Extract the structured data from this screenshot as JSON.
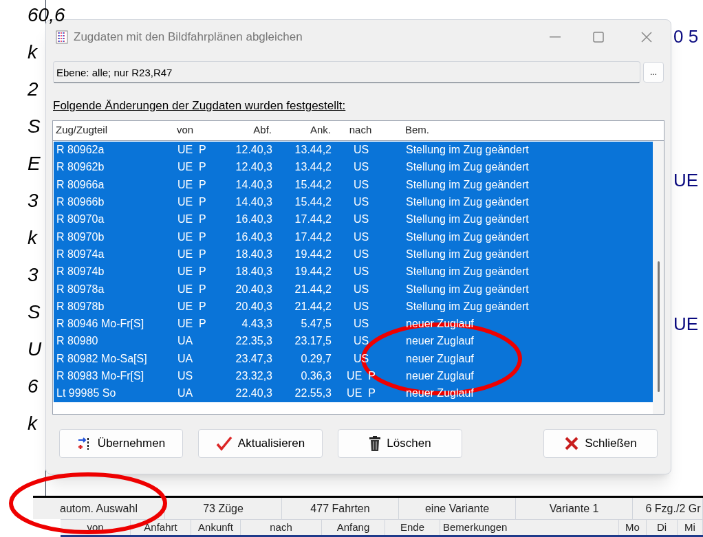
{
  "background": {
    "left_fragments": [
      "60,6",
      "k",
      "2",
      "S",
      "E",
      "3",
      "k",
      "3",
      "S",
      "U",
      "6",
      "k"
    ],
    "right_fragments": [
      "0 5",
      "UE",
      "UE"
    ],
    "status_bar": [
      "autom. Auswahl",
      "73 Züge",
      "477 Fahrten",
      "eine Variante",
      "Variante 1",
      "6 Fzg./2 Gr"
    ],
    "table_columns": [
      "von",
      "Anfahrt",
      "Ankunft",
      "nach",
      "Anfang",
      "Ende",
      "Bemerkungen",
      "Mo",
      "Di",
      "Mi"
    ]
  },
  "window": {
    "title": "Zugdaten mit den Bildfahrplänen abgleichen",
    "filter": {
      "value": "Ebene: alle; nur R23,R47",
      "button": "..."
    },
    "heading": "Folgende Änderungen der Zugdaten wurden festgestellt:",
    "table": {
      "columns": [
        "Zug/Zugteil",
        "von",
        "Abf.",
        "Ank.",
        "nach",
        "Bem."
      ],
      "rows": [
        {
          "cells": [
            "R 80962a",
            "UE  P",
            "12.40,3",
            "13.44,2",
            "US",
            "Stellung im Zug geändert"
          ],
          "selected": true
        },
        {
          "cells": [
            "R 80962b",
            "UE  P",
            "12.40,3",
            "13.44,2",
            "US",
            "Stellung im Zug geändert"
          ],
          "selected": true
        },
        {
          "cells": [
            "R 80966a",
            "UE  P",
            "14.40,3",
            "15.44,2",
            "US",
            "Stellung im Zug geändert"
          ],
          "selected": true
        },
        {
          "cells": [
            "R 80966b",
            "UE  P",
            "14.40,3",
            "15.44,2",
            "US",
            "Stellung im Zug geändert"
          ],
          "selected": true
        },
        {
          "cells": [
            "R 80970a",
            "UE  P",
            "16.40,3",
            "17.44,2",
            "US",
            "Stellung im Zug geändert"
          ],
          "selected": true
        },
        {
          "cells": [
            "R 80970b",
            "UE  P",
            "16.40,3",
            "17.44,2",
            "US",
            "Stellung im Zug geändert"
          ],
          "selected": true
        },
        {
          "cells": [
            "R 80974a",
            "UE  P",
            "18.40,3",
            "19.44,2",
            "US",
            "Stellung im Zug geändert"
          ],
          "selected": true
        },
        {
          "cells": [
            "R 80974b",
            "UE  P",
            "18.40,3",
            "19.44,2",
            "US",
            "Stellung im Zug geändert"
          ],
          "selected": true
        },
        {
          "cells": [
            "R 80978a",
            "UE  P",
            "20.40,3",
            "21.44,2",
            "US",
            "Stellung im Zug geändert"
          ],
          "selected": true
        },
        {
          "cells": [
            "R 80978b",
            "UE  P",
            "20.40,3",
            "21.44,2",
            "US",
            "Stellung im Zug geändert"
          ],
          "selected": true
        },
        {
          "cells": [
            "R 80946 Mo-Fr[S]",
            "UE  P",
            "4.43,3",
            "5.47,5",
            "US",
            "neuer Zuglauf"
          ],
          "selected": true
        },
        {
          "cells": [
            "R 80980",
            "UA",
            "22.35,3",
            "23.17,5",
            "US",
            "neuer Zuglauf"
          ],
          "selected": true
        },
        {
          "cells": [
            "R 80982 Mo-Sa[S]",
            "UA",
            "23.47,3",
            "0.29,7",
            "US",
            "neuer Zuglauf"
          ],
          "selected": true
        },
        {
          "cells": [
            "R 80983 Mo-Fr[S]",
            "US",
            "23.32,3",
            "0.36,3",
            "UE  P",
            "neuer Zuglauf"
          ],
          "selected": true
        },
        {
          "cells": [
            "Lt 99985 So",
            "UA",
            "22.40,3",
            "22.55,3",
            "UE  P",
            "neuer Zuglauf"
          ],
          "selected": true
        }
      ]
    },
    "buttons": [
      {
        "kind": "apply",
        "label": "Übernehmen"
      },
      {
        "kind": "update",
        "label": "Aktualisieren"
      },
      {
        "kind": "delete",
        "label": "Löschen"
      },
      {
        "kind": "close",
        "label": "Schließen"
      }
    ]
  }
}
